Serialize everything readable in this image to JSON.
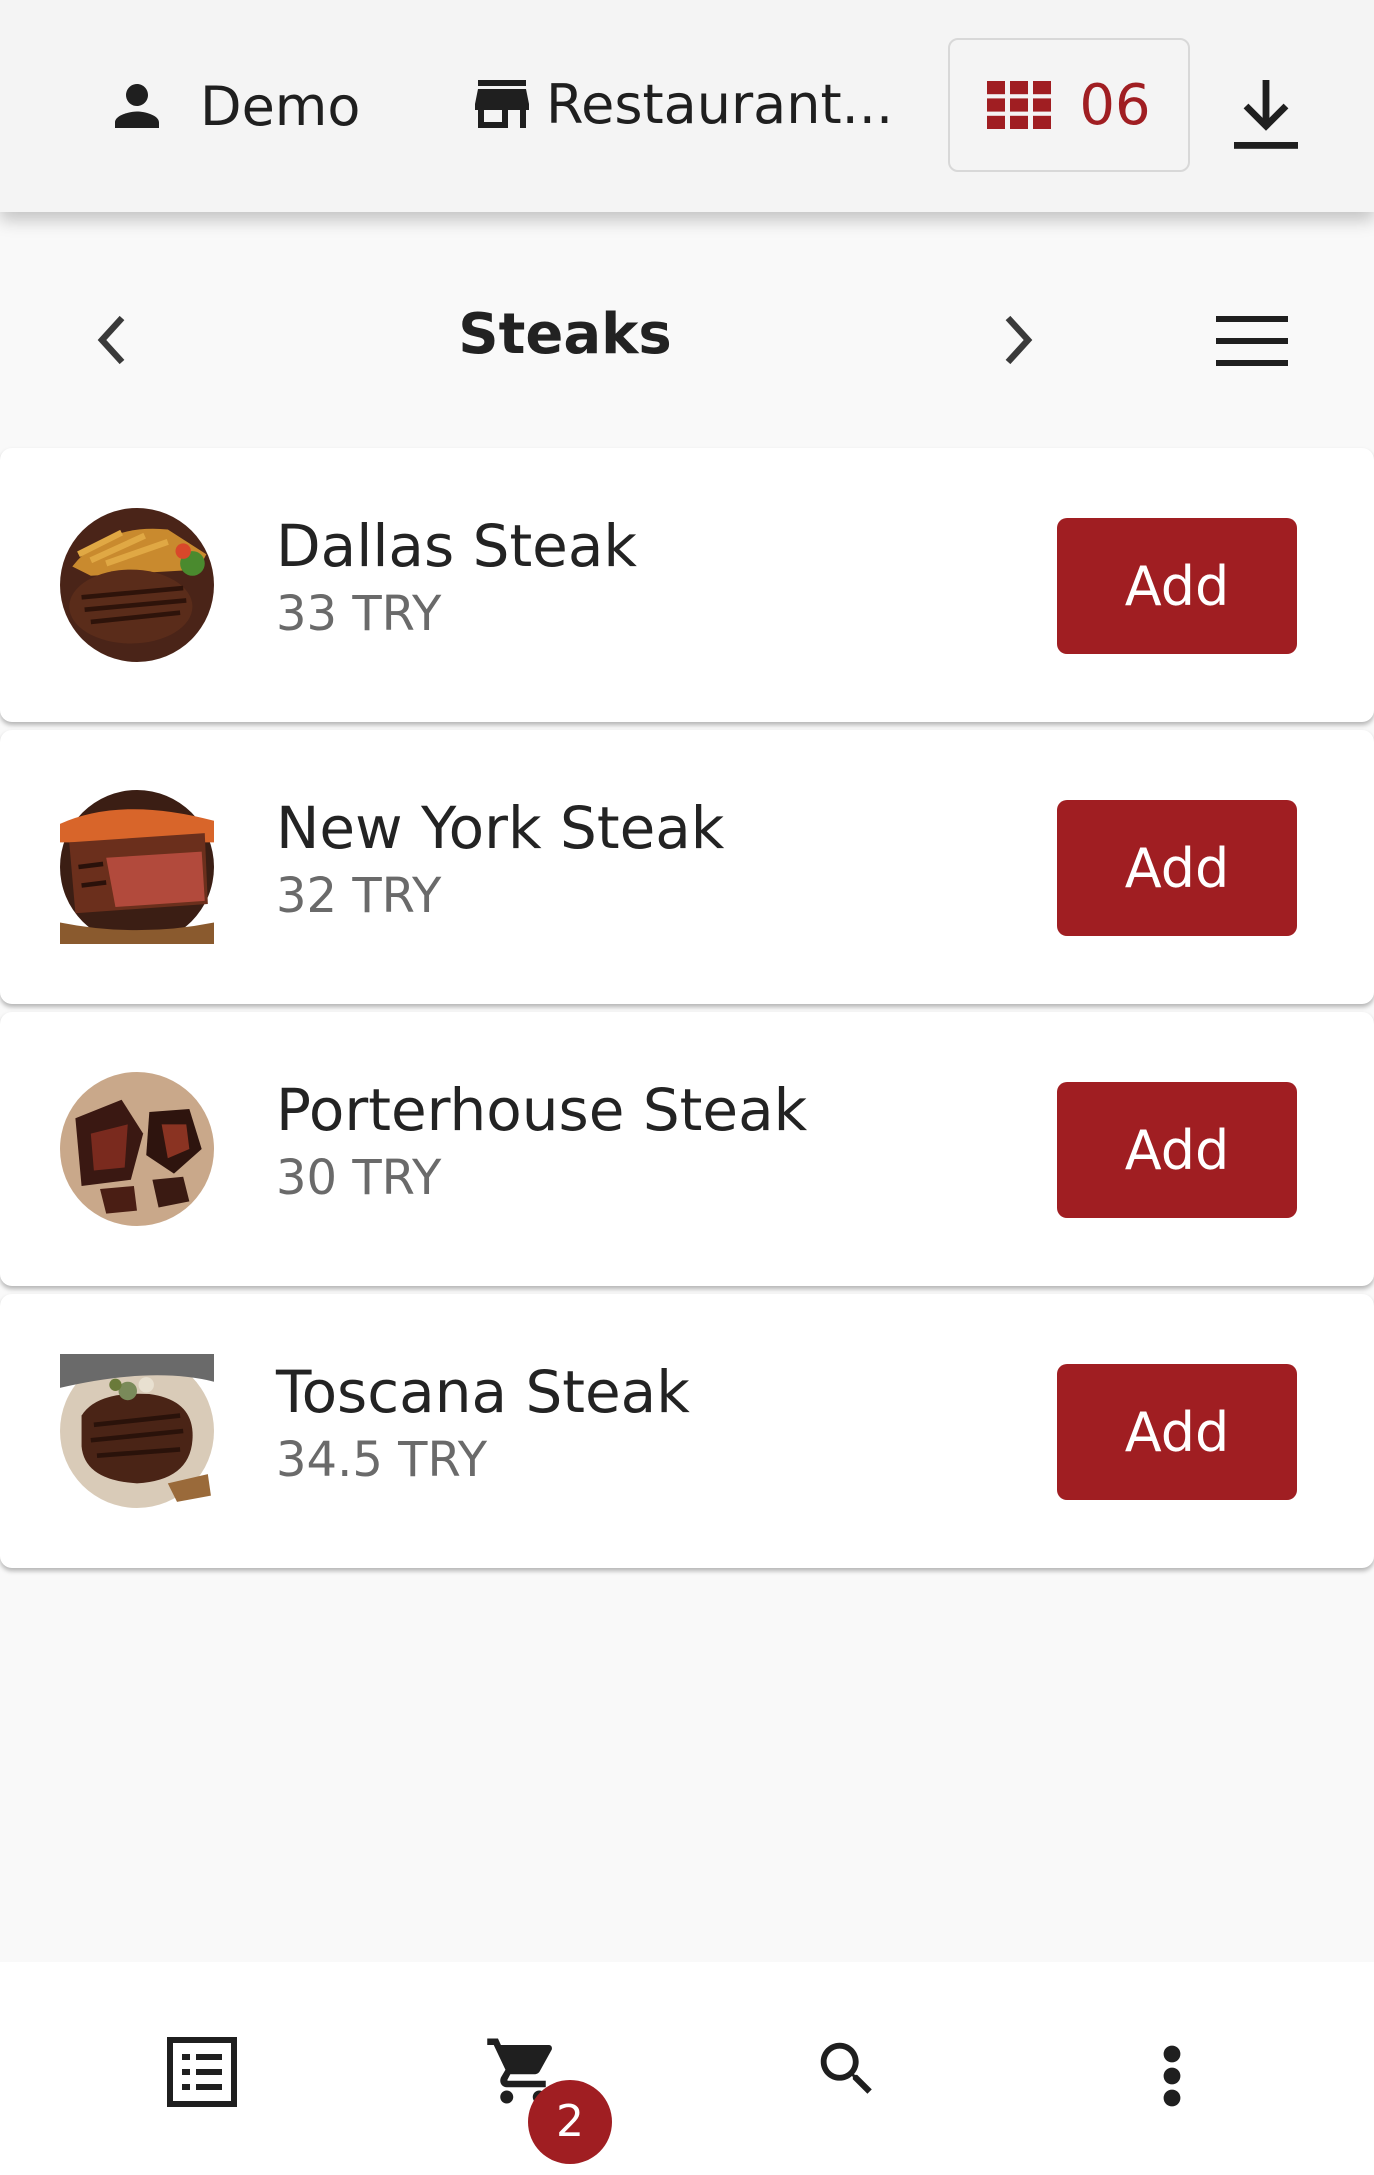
{
  "header": {
    "user_name": "Demo",
    "restaurant_name": "Restaurant...",
    "table_number": "06",
    "user_icon": "person-icon",
    "restaurant_icon": "storefront-icon",
    "table_icon": "grid-icon",
    "download_icon": "download-icon"
  },
  "category": {
    "title": "Steaks",
    "prev_icon": "chevron-left-icon",
    "next_icon": "chevron-right-icon",
    "menu_icon": "hamburger-menu-icon"
  },
  "products": [
    {
      "name": "Dallas Steak",
      "price": "33 TRY",
      "add_label": "Add"
    },
    {
      "name": "New York Steak",
      "price": "32 TRY",
      "add_label": "Add"
    },
    {
      "name": "Porterhouse Steak",
      "price": "30 TRY",
      "add_label": "Add"
    },
    {
      "name": "Toscana Steak",
      "price": "34.5 TRY",
      "add_label": "Add"
    }
  ],
  "bottom_nav": {
    "cart_count": "2",
    "items": [
      "list-icon",
      "cart-icon",
      "search-icon",
      "more-vertical-icon"
    ]
  },
  "colors": {
    "accent": "#a01e22",
    "header_bg": "#f4f4f4",
    "page_bg": "#f9f9f9",
    "card_bg": "#ffffff"
  }
}
